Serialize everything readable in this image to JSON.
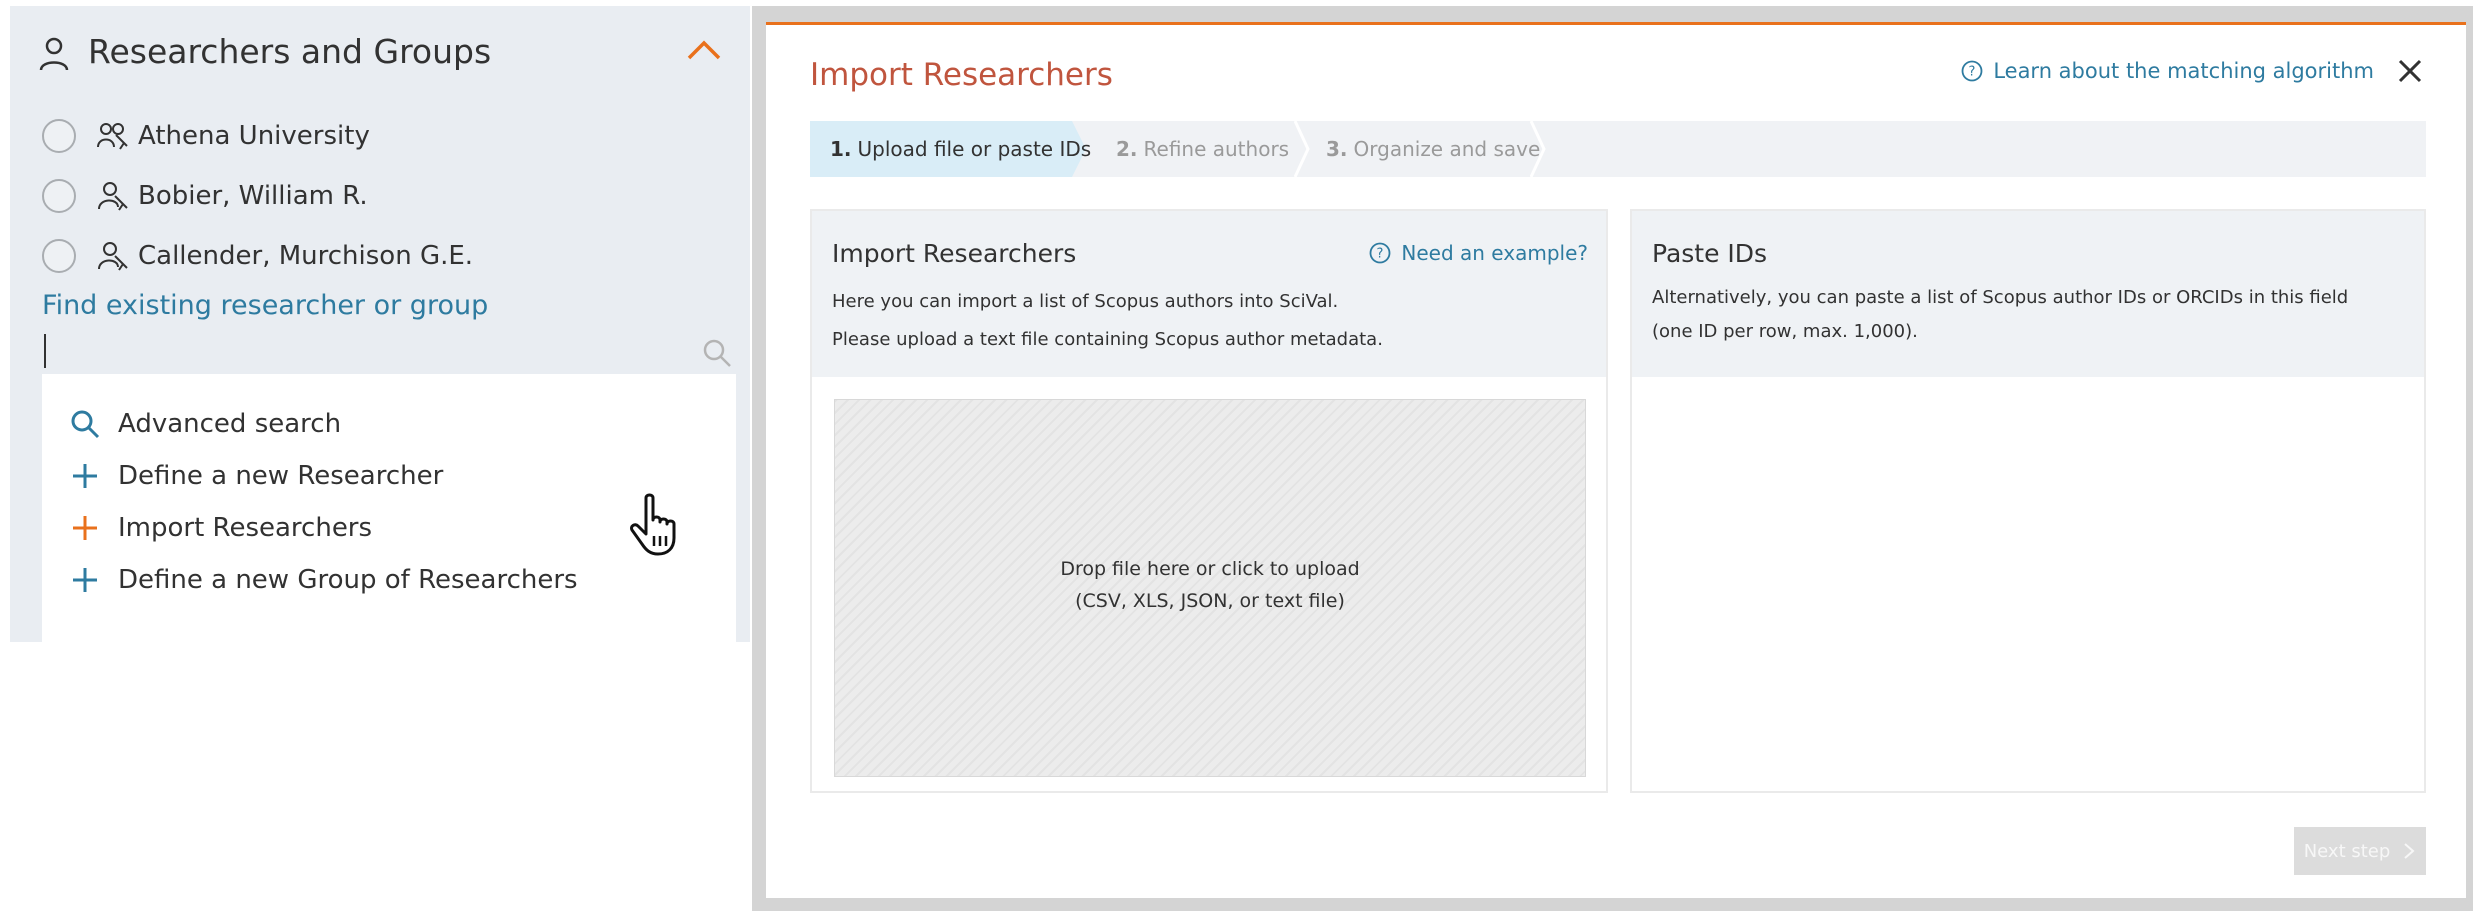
{
  "sidebar": {
    "title": "Researchers and Groups",
    "items": [
      {
        "label": "Athena University",
        "icon": "group-icon"
      },
      {
        "label": "Bobier, William R.",
        "icon": "researcher-icon"
      },
      {
        "label": "Callender, Murchison G.E.",
        "icon": "researcher-icon"
      }
    ],
    "find_label": "Find existing researcher or group",
    "search_value": "",
    "menu": [
      {
        "label": "Advanced search",
        "icon": "search-icon"
      },
      {
        "label": "Define a new Researcher",
        "icon": "plus-icon"
      },
      {
        "label": "Import Researchers",
        "icon": "plus-icon"
      },
      {
        "label": "Define a new Group of Researchers",
        "icon": "plus-icon"
      }
    ]
  },
  "modal": {
    "title": "Import Researchers",
    "learn_link": "Learn about the matching algorithm",
    "steps": [
      {
        "num": "1.",
        "label": "Upload file or paste IDs",
        "active": true
      },
      {
        "num": "2.",
        "label": "Refine authors",
        "active": false
      },
      {
        "num": "3.",
        "label": "Organize and save",
        "active": false
      }
    ],
    "import_card": {
      "title": "Import Researchers",
      "help_link": "Need an example?",
      "line1": "Here you can import a list of Scopus authors into SciVal.",
      "line2": "Please upload a text file containing Scopus author metadata.",
      "drop_line1": "Drop file here or click to upload",
      "drop_line2": "(CSV, XLS, JSON, or text file)"
    },
    "paste_card": {
      "title": "Paste IDs",
      "line1": "Alternatively, you can paste a list of Scopus author IDs or ORCIDs in this field",
      "line2": "(one ID per row, max. 1,000).",
      "value": ""
    },
    "next_button": "Next step"
  },
  "colors": {
    "accent_orange": "#e9711c",
    "title_red": "#c0553e",
    "link_blue": "#2e7ba0",
    "panel_bg": "#e9edf2",
    "active_step_bg": "#d9edf7",
    "disabled_button": "#dcdcdc"
  }
}
